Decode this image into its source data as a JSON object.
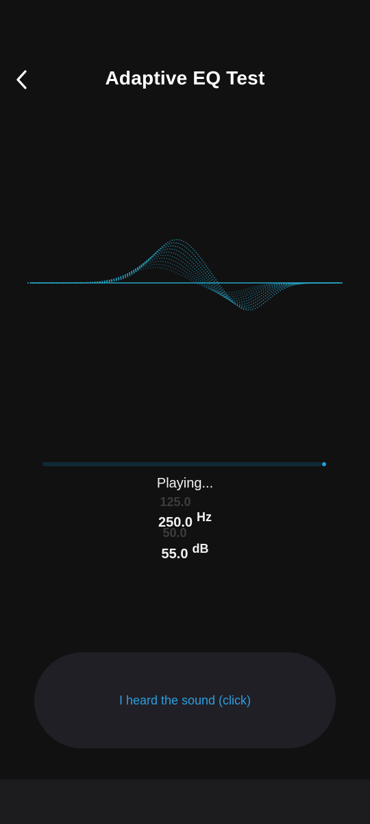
{
  "header": {
    "title": "Adaptive EQ Test",
    "back_icon": "chevron-left-icon"
  },
  "player": {
    "status": "Playing...",
    "progress": 1.0
  },
  "frequency": {
    "previous": "125.0",
    "current": "250.0",
    "unit": "Hz"
  },
  "level": {
    "previous": "50.0",
    "current": "55.0",
    "unit": "dB"
  },
  "action": {
    "label": "I heard the sound (click)"
  },
  "colors": {
    "background": "#111112",
    "accent": "#2a9fe0",
    "waveform": "#2bb5d8",
    "button_bg": "#211f26"
  }
}
